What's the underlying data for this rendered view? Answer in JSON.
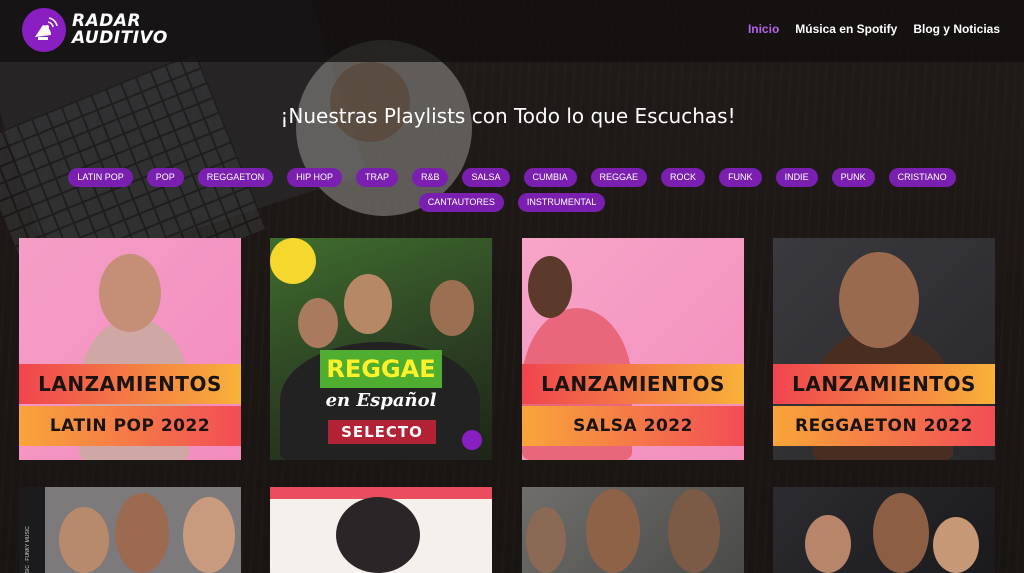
{
  "brand": {
    "line1": "RADAR",
    "line2": "AUDITIVO"
  },
  "nav": {
    "items": [
      "Inicio",
      "Música en Spotify",
      "Blog y Noticias"
    ],
    "active_index": 0
  },
  "heading": "¡Nuestras Playlists con Todo lo que Escuchas!",
  "tags": [
    "LATIN POP",
    "POP",
    "REGGAETON",
    "HIP HOP",
    "TRAP",
    "R&B",
    "SALSA",
    "CUMBIA",
    "REGGAE",
    "ROCK",
    "FUNK",
    "INDIE",
    "PUNK",
    "CRISTIANO",
    "CANTAUTORES",
    "INSTRUMENTAL"
  ],
  "cards": [
    {
      "line1": "LANZAMIENTOS",
      "line2": "LATIN POP 2022"
    },
    {
      "line1": "REGGAE",
      "line2": "en Español",
      "line3": "SELECTO"
    },
    {
      "line1": "LANZAMIENTOS",
      "line2": "SALSA 2022"
    },
    {
      "line1": "LANZAMIENTOS",
      "line2": "REGGAETON 2022"
    }
  ],
  "bottom_cards": [
    {
      "side_text": "USIC · FUNKY MUSIC"
    },
    {},
    {},
    {}
  ],
  "colors": {
    "accent": "#8a1fc1",
    "tag_bg": "#7a1fb0",
    "nav_active": "#b363e8"
  }
}
